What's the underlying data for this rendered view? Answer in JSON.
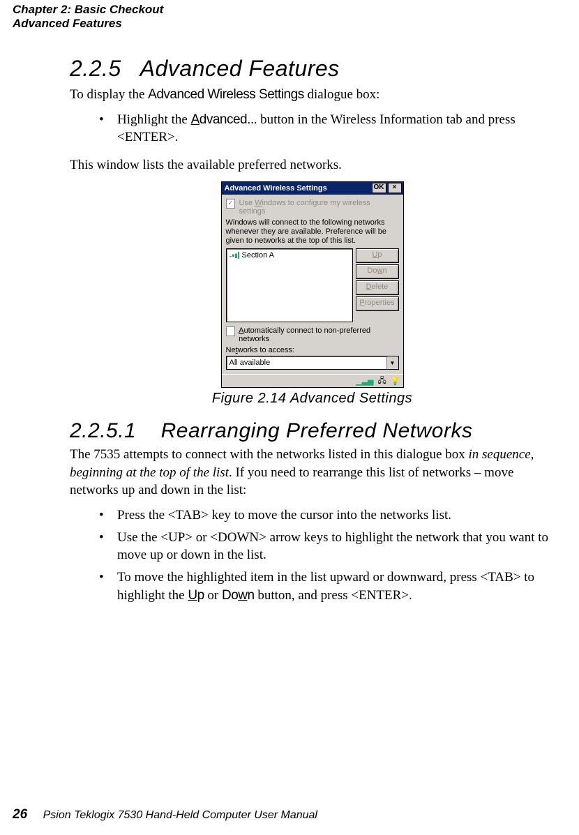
{
  "header": {
    "line1": "Chapter 2: Basic Checkout",
    "line2": "Advanced Features"
  },
  "section": {
    "number": "2.2.5",
    "title": "Advanced Features",
    "intro_prefix": "To display the ",
    "intro_em": "Advanced Wireless Settings",
    "intro_suffix": " dialogue box:",
    "bullet1_prefix": "Highlight the ",
    "bullet1_em": "Advanced...",
    "bullet1_suffix": " button in the Wireless Information tab and press <ENTER>.",
    "para2": "This window lists the available preferred networks."
  },
  "figure": {
    "caption": "Figure 2.14 Advanced Settings",
    "titlebar": "Advanced Wireless Settings",
    "ok": "OK",
    "close": "×",
    "chk1_a": "Use ",
    "chk1_u": "W",
    "chk1_b": "indows to configure my wireless settings",
    "info": "Windows will connect to the following networks whenever they are available. Preference will be given to networks at the top of this list.",
    "list_item": "Section A",
    "btn_up_u": "U",
    "btn_up_r": "p",
    "btn_down": "Do",
    "btn_down_u": "w",
    "btn_down_r": "n",
    "btn_del_u": "D",
    "btn_del_r": "elete",
    "btn_prop_u": "P",
    "btn_prop_r": "roperties",
    "chk2_u": "A",
    "chk2_r": "utomatically connect to non-preferred networks",
    "label_net_a": "Ne",
    "label_net_u": "t",
    "label_net_b": "works to access:",
    "combo": "All available"
  },
  "sub": {
    "number": "2.2.5.1",
    "title": "Rearranging Preferred Networks",
    "p_a": "The 7535 attempts to connect with the networks listed in this dialogue box ",
    "p_em": "in sequence, beginning at the top of the list",
    "p_b": ". If you need to rearrange this list of networks – move networks up and down in the list:",
    "b1": "Press the <TAB> key to move the cursor into the networks list.",
    "b2": "Use the <UP> or <DOWN> arrow keys to highlight the network that you want to move up or down in the list.",
    "b3_a": "To move the highlighted item in the list upward or downward, press <TAB> to highlight the ",
    "b3_up_u": "U",
    "b3_up_r": "p",
    "b3_mid": " or ",
    "b3_dn_a": "Do",
    "b3_dn_u": "w",
    "b3_dn_b": "n",
    "b3_end": " button, and press <ENTER>."
  },
  "footer": {
    "page": "26",
    "text": "Psion Teklogix 7530 Hand-Held Computer User Manual"
  }
}
